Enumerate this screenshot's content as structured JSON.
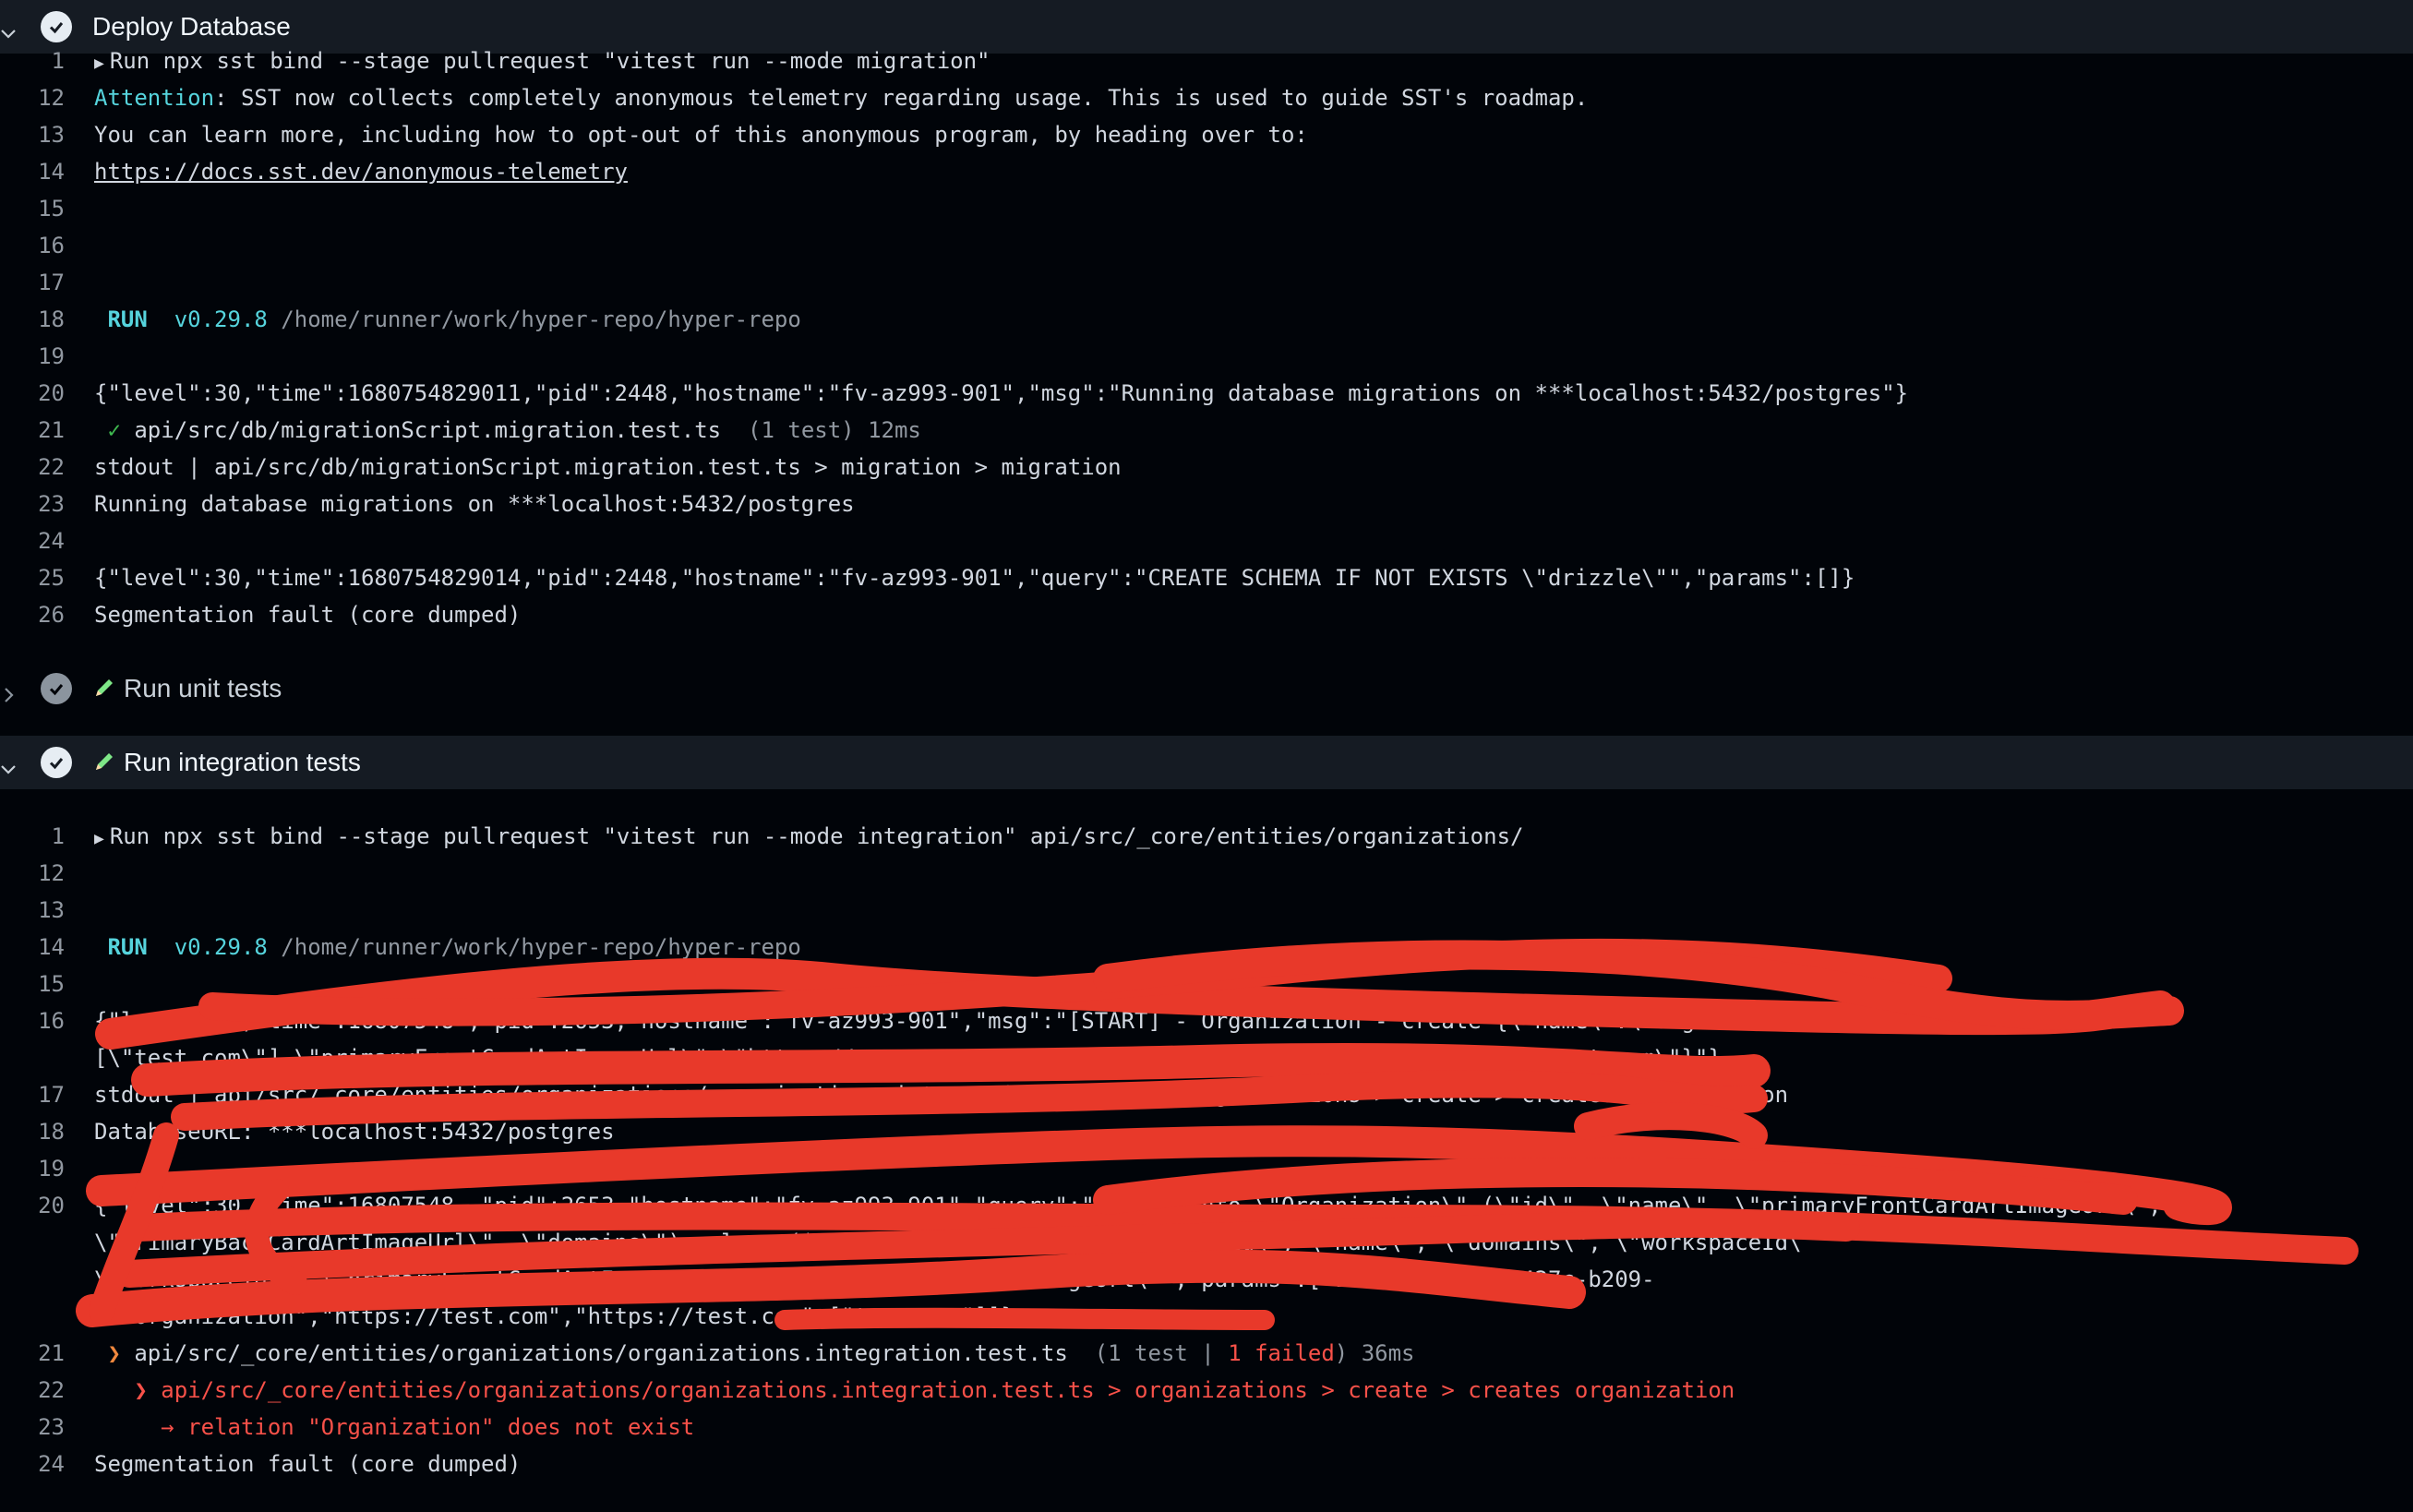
{
  "steps": {
    "deploy": {
      "title": "Deploy Database"
    },
    "unit": {
      "title": "Run unit tests"
    },
    "integration": {
      "title": "Run integration tests"
    }
  },
  "deploy_log": [
    {
      "n": "1",
      "text": "Run npx sst bind --stage pullrequest \"vitest run --mode migration\""
    },
    {
      "n": "12",
      "attn": "Attention",
      "text": ": SST now collects completely anonymous telemetry regarding usage. This is used to guide SST's roadmap."
    },
    {
      "n": "13",
      "text": "You can learn more, including how to opt-out of this anonymous program, by heading over to:"
    },
    {
      "n": "14",
      "text": "https://docs.sst.dev/anonymous-telemetry"
    },
    {
      "n": "15",
      "text": ""
    },
    {
      "n": "16",
      "text": ""
    },
    {
      "n": "17",
      "text": ""
    },
    {
      "n": "18",
      "run": "RUN",
      "ver": "v0.29.8",
      "text": " /home/runner/work/hyper-repo/hyper-repo"
    },
    {
      "n": "19",
      "text": ""
    },
    {
      "n": "20",
      "text": "{\"level\":30,\"time\":1680754829011,\"pid\":2448,\"hostname\":\"fv-az993-901\",\"msg\":\"Running database migrations on ***localhost:5432/postgres\"}"
    },
    {
      "n": "21",
      "mark": "✓",
      "text": " api/src/db/migrationScript.migration.test.ts",
      "extra": "  (1 test) 12ms"
    },
    {
      "n": "22",
      "text": "stdout | api/src/db/migrationScript.migration.test.ts > migration > migration"
    },
    {
      "n": "23",
      "text": "Running database migrations on ***localhost:5432/postgres"
    },
    {
      "n": "24",
      "text": ""
    },
    {
      "n": "25",
      "text": "{\"level\":30,\"time\":1680754829014,\"pid\":2448,\"hostname\":\"fv-az993-901\",\"query\":\"CREATE SCHEMA IF NOT EXISTS \\\"drizzle\\\"\",\"params\":[]}"
    },
    {
      "n": "26",
      "text": "Segmentation fault (core dumped)"
    }
  ],
  "integration_log": [
    {
      "n": "1",
      "text": "Run npx sst bind --stage pullrequest \"vitest run --mode integration\" api/src/_core/entities/organizations/"
    },
    {
      "n": "12",
      "text": ""
    },
    {
      "n": "13",
      "text": ""
    },
    {
      "n": "14",
      "run": "RUN",
      "ver": "v0.29.8",
      "text": " /home/runner/work/hyper-repo/hyper-repo"
    },
    {
      "n": "15",
      "text": ""
    },
    {
      "n": "16",
      "text": "{\"level\":30,\"time\":16807548 ,\"pid\":2653,\"hostname\":\"fv-az993-901\",\"msg\":\"[START] - Organization - create {\\\"name\\\":\\\"Organization\\\"\","
    },
    {
      "n": "",
      "text": "[\\\"test.com\\\"],\\\"primaryFrontCardArtImageUrl\\\":\\\"https://test.com\\\",\\\"primaryBackCardArtImageUrl\\\":\\\"https://test.com\\\"}\"}"
    },
    {
      "n": "17",
      "text": "stdout | api/src/_core/entities/organizations/organizations.integration.test.ts > organizations > create > creates organization"
    },
    {
      "n": "18",
      "text": "DatabaseURL: ***localhost:5432/postgres"
    },
    {
      "n": "19",
      "text": ""
    },
    {
      "n": "20",
      "text": "{\"level\":30,\"time\":16807548 ,\"pid\":2653,\"hostname\":\"fv-az993-901\",\"query\":\"insert into \\\"Organization\\\" (\\\"id\\\", \\\"name\\\", \\\"primaryFrontCardArtImageUrl\\\","
    },
    {
      "n": "",
      "text": "\\\"primaryBackCardArtImageUrl\\\", \\\"domains\\\") values ($1, $2, $3, $4, $5) returning \\\"id\\\", \\\"name\\\", \\\"domains\\\", \\\"workspaceId\\\""
    },
    {
      "n": "",
      "text": "\\\"workspaceId\\\", \\\"primaryFrontCardArtImageUrl\\\", \\\"primaryBackCardArtImageUrl\\\"\",\"params\":[\"1427864c-c3ee-427c-b209-"
    },
    {
      "n": "",
      "text": "   Organization\",\"https://test.com\",\"https://test.com\",[\"test.com\"]]}"
    },
    {
      "n": "21",
      "arrow": "❯",
      "text": " api/src/_core/entities/organizations/organizations.integration.test.ts",
      "extra1": "  (1 test | ",
      "failed": "1 failed",
      "extra2": ") 36ms"
    },
    {
      "n": "22",
      "arrow": "❯",
      "text": " api/src/_core/entities/organizations/organizations.integration.test.ts > organizations > create > creates organization"
    },
    {
      "n": "23",
      "text": "→ relation \"Organization\" does not exist"
    },
    {
      "n": "24",
      "text": "Segmentation fault (core dumped)"
    }
  ]
}
